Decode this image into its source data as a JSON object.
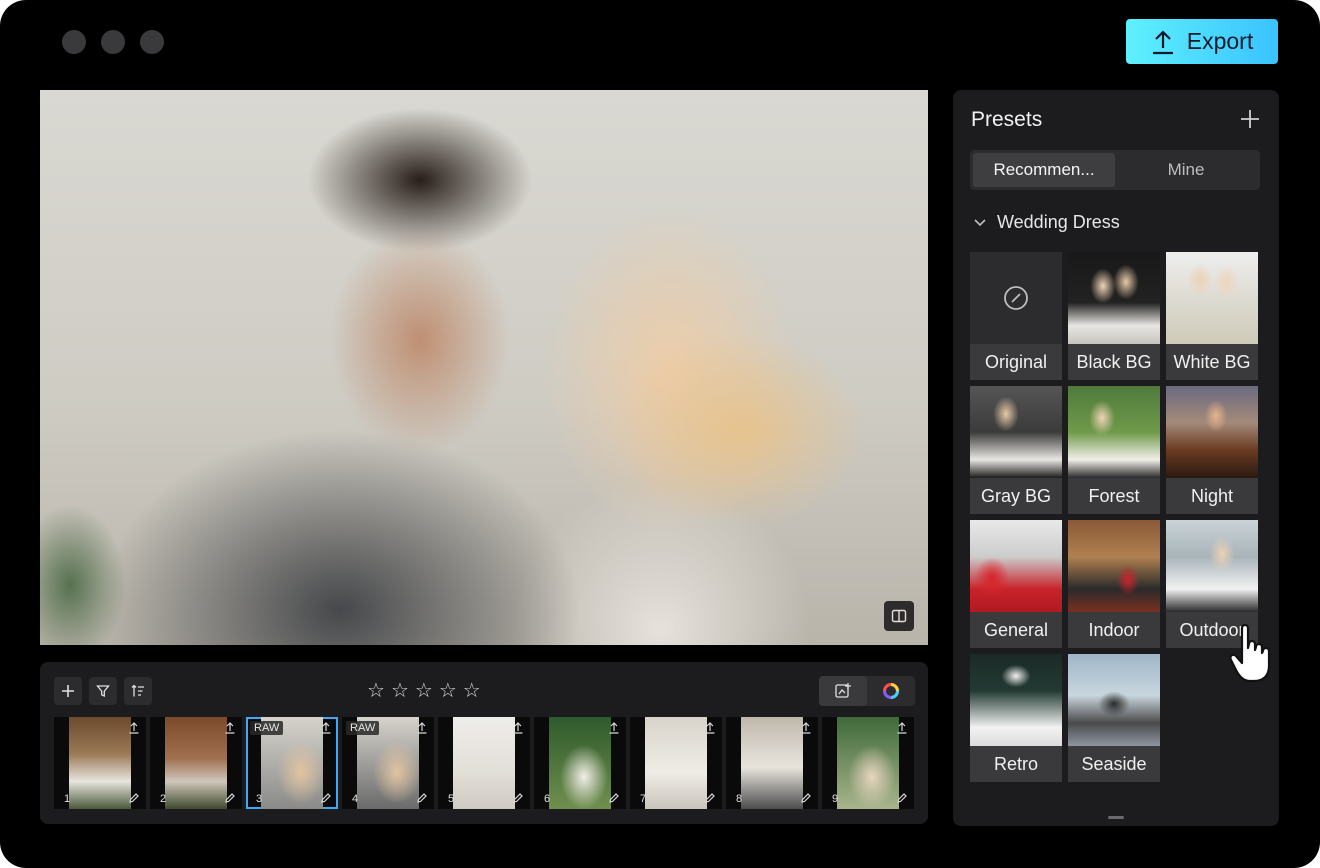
{
  "toolbar": {
    "export_label": "Export"
  },
  "filmstrip": {
    "rating_stars": 5,
    "thumbnails": [
      {
        "num": "1",
        "raw": ""
      },
      {
        "num": "2",
        "raw": ""
      },
      {
        "num": "3",
        "raw": "RAW"
      },
      {
        "num": "4",
        "raw": "RAW"
      },
      {
        "num": "5",
        "raw": ""
      },
      {
        "num": "6",
        "raw": ""
      },
      {
        "num": "7",
        "raw": ""
      },
      {
        "num": "8",
        "raw": ""
      },
      {
        "num": "9",
        "raw": ""
      }
    ],
    "selected_index": 3
  },
  "presets": {
    "title": "Presets",
    "tabs": [
      "Recommen...",
      "Mine"
    ],
    "active_tab": "Recommen...",
    "section": "Wedding Dress",
    "items": [
      {
        "label": "Original"
      },
      {
        "label": "Black BG"
      },
      {
        "label": "White BG"
      },
      {
        "label": "Gray BG"
      },
      {
        "label": "Forest"
      },
      {
        "label": "Night"
      },
      {
        "label": "General"
      },
      {
        "label": "Indoor"
      },
      {
        "label": "Outdoor"
      },
      {
        "label": "Retro"
      },
      {
        "label": "Seaside"
      }
    ],
    "selected": "Outdoor"
  },
  "colors": {
    "accent": "#3fa9f5",
    "export_gradient_start": "#5ff0ff",
    "export_gradient_end": "#39c3ff"
  }
}
